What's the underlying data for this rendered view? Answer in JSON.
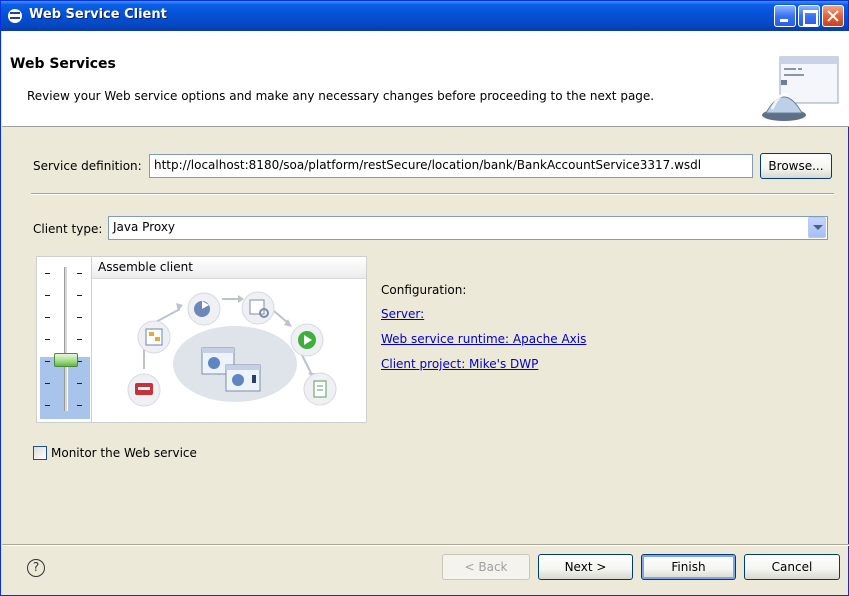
{
  "window": {
    "title": "Web Service Client",
    "controls": [
      "minimize-icon",
      "maximize-icon",
      "close-icon"
    ]
  },
  "banner": {
    "heading": "Web Services",
    "description": "Review your Web service options and make any necessary changes before proceeding to the next page."
  },
  "service_definition": {
    "label": "Service definition:",
    "value": "http://localhost:8180/soa/platform/restSecure/location/bank/BankAccountService3317.wsdl",
    "browse_label": "Browse..."
  },
  "client_type": {
    "label": "Client type:",
    "selected": "Java Proxy"
  },
  "slider": {
    "stage_label": "Assemble client",
    "level": 0.35
  },
  "configuration": {
    "heading": "Configuration:",
    "server": "Server: ",
    "runtime": "Web service runtime: Apache Axis",
    "project": "Client project: Mike's DWP"
  },
  "monitor": {
    "label": "Monitor the Web service",
    "checked": false
  },
  "footer": {
    "back": "< Back",
    "next": "Next >",
    "finish": "Finish",
    "cancel": "Cancel",
    "help_glyph": "?"
  },
  "colors": {
    "titlebar": "#0553d8",
    "dialog_bg": "#ece9d8",
    "link": "#0000cc"
  }
}
